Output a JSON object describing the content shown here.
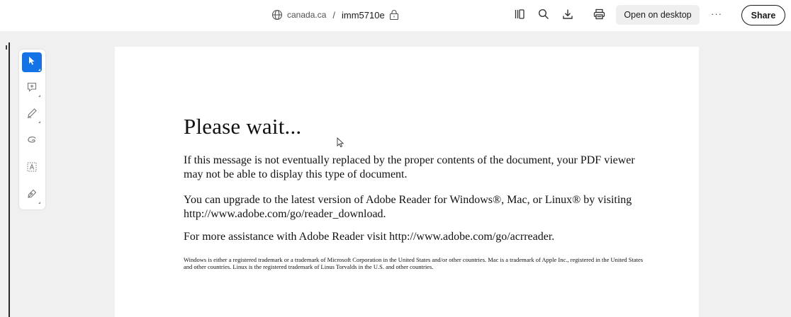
{
  "header": {
    "site": "canada.ca",
    "separator": "/",
    "file_name": "imm5710e",
    "open_desktop_label": "Open on desktop",
    "more_label": "···",
    "share_label": "Share",
    "icons": [
      "globe-icon",
      "lock-icon",
      "pages-panel-icon",
      "search-icon",
      "download-icon",
      "print-icon"
    ]
  },
  "rail": {
    "tools": [
      {
        "name": "select-tool",
        "icon": "arrow-cursor-icon",
        "active": true
      },
      {
        "name": "comment-tool",
        "icon": "add-comment-icon",
        "active": false
      },
      {
        "name": "draw-tool",
        "icon": "pen-icon",
        "active": false
      },
      {
        "name": "freeform-tool",
        "icon": "lasso-icon",
        "active": false
      },
      {
        "name": "text-tool",
        "icon": "text-box-icon",
        "active": false
      },
      {
        "name": "sign-tool",
        "icon": "sign-pen-icon",
        "active": false
      }
    ]
  },
  "document": {
    "title": "Please wait...",
    "paragraphs": [
      "If this message is not eventually replaced by the proper contents of the document, your PDF viewer may not be able to display this type of document.",
      "You can upgrade to the latest version of Adobe Reader for Windows®, Mac, or Linux® by visiting  http://www.adobe.com/go/reader_download.",
      "For more assistance with Adobe Reader visit  http://www.adobe.com/go/acrreader."
    ],
    "fine_print": "Windows is either a registered trademark or a trademark of Microsoft Corporation in the United States and/or other countries. Mac is a trademark of Apple Inc., registered in the United States and other countries. Linux is the registered trademark of Linus Torvalds in the U.S. and other countries."
  },
  "colors": {
    "accent": "#1473e6",
    "background": "#f0f0f0",
    "page": "#ffffff"
  }
}
